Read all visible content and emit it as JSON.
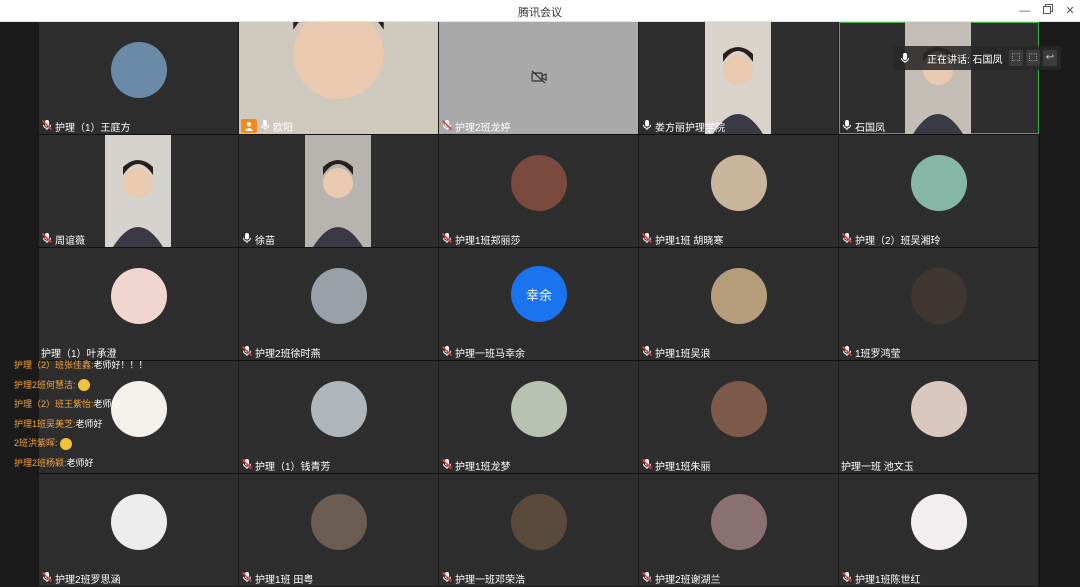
{
  "window": {
    "title": "腾讯会议",
    "controls": [
      "minimize",
      "restore",
      "close"
    ]
  },
  "speaking_indicator": {
    "label": "正在讲话: 石国凤"
  },
  "participants": [
    {
      "name": "护理（1）王庭方",
      "mic": "muted",
      "kind": "avatar",
      "avatar_color": "#6b8aa8"
    },
    {
      "name": "欧阳",
      "mic": "on",
      "kind": "video",
      "host": true,
      "video_color": "#cfc8bd"
    },
    {
      "name": "护理2班龙婷",
      "mic": "muted",
      "kind": "camoff"
    },
    {
      "name": "娄方丽护理学院",
      "mic": "on",
      "kind": "video",
      "video_color": "#d9d3cc"
    },
    {
      "name": "石国凤",
      "mic": "on",
      "kind": "video",
      "speaking": true,
      "video_color": "#c4bdb6"
    },
    {
      "name": "周谊薇",
      "mic": "muted",
      "kind": "video",
      "video_color": "#d6d2cd"
    },
    {
      "name": "徐苗",
      "mic": "on",
      "kind": "video",
      "video_color": "#b7b4b0"
    },
    {
      "name": "护理1班郑丽莎",
      "mic": "muted",
      "kind": "avatar",
      "avatar_color": "#7a4a3e"
    },
    {
      "name": "护理1班 胡晓寒",
      "mic": "muted",
      "kind": "avatar",
      "avatar_color": "#c9b59c"
    },
    {
      "name": "护理（2）班吴湘玲",
      "mic": "muted",
      "kind": "avatar",
      "avatar_color": "#86b7a6"
    },
    {
      "name": "护理（1）叶承澄",
      "mic": "none",
      "kind": "avatar",
      "avatar_color": "#f1d6cf"
    },
    {
      "name": "护理2班徐时燕",
      "mic": "muted",
      "kind": "avatar",
      "avatar_color": "#9aa0a7"
    },
    {
      "name": "护理一班马幸余",
      "mic": "muted",
      "kind": "text",
      "avatar_text": "幸余"
    },
    {
      "name": "护理1班吴浪",
      "mic": "muted",
      "kind": "avatar",
      "avatar_color": "#b59c7b"
    },
    {
      "name": "1班罗鸿莹",
      "mic": "muted",
      "kind": "avatar",
      "avatar_color": "#403632"
    },
    {
      "name": "",
      "mic": "none",
      "kind": "avatar",
      "avatar_color": "#f4f0ec"
    },
    {
      "name": "护理（1）钱青芳",
      "mic": "muted",
      "kind": "avatar",
      "avatar_color": "#aeb6bb"
    },
    {
      "name": "护理1班龙梦",
      "mic": "muted",
      "kind": "avatar",
      "avatar_color": "#b9c2b2"
    },
    {
      "name": "护理1班朱丽",
      "mic": "muted",
      "kind": "avatar",
      "avatar_color": "#7d5a4a"
    },
    {
      "name": "护理一班 池文玉",
      "mic": "none",
      "kind": "avatar",
      "avatar_color": "#d9c8bf"
    },
    {
      "name": "护理2班罗思涵",
      "mic": "muted",
      "kind": "avatar",
      "avatar_color": "#ececec"
    },
    {
      "name": "护理1班 田粤",
      "mic": "muted",
      "kind": "avatar",
      "avatar_color": "#6b5d53"
    },
    {
      "name": "护理一班邓荣浩",
      "mic": "muted",
      "kind": "avatar",
      "avatar_color": "#5a4a3c"
    },
    {
      "name": "护理2班谢湖兰",
      "mic": "muted",
      "kind": "avatar",
      "avatar_color": "#8a7070"
    },
    {
      "name": "护理1班陈世红",
      "mic": "muted",
      "kind": "avatar",
      "avatar_color": "#f2eef0"
    }
  ],
  "chat_danmaku": [
    {
      "who": "护理（2）班张佳鑫:",
      "text": "老师好！！！",
      "emoji": false
    },
    {
      "who": "护理2班何慧洁:",
      "text": "",
      "emoji": true
    },
    {
      "who": "护理（2）班王紫怡:",
      "text": "老师好",
      "emoji": false
    },
    {
      "who": "护理1班吴美芝:",
      "text": "老师好",
      "emoji": false
    },
    {
      "who": "2班洪紫晖:",
      "text": "",
      "emoji": true
    },
    {
      "who": "护理2班杨颖:",
      "text": "老师好",
      "emoji": false
    }
  ],
  "colors": {
    "accent_avatar": "#1a74f0",
    "speaking_border": "#3fb04a",
    "chat_name": "#f2a13b"
  }
}
